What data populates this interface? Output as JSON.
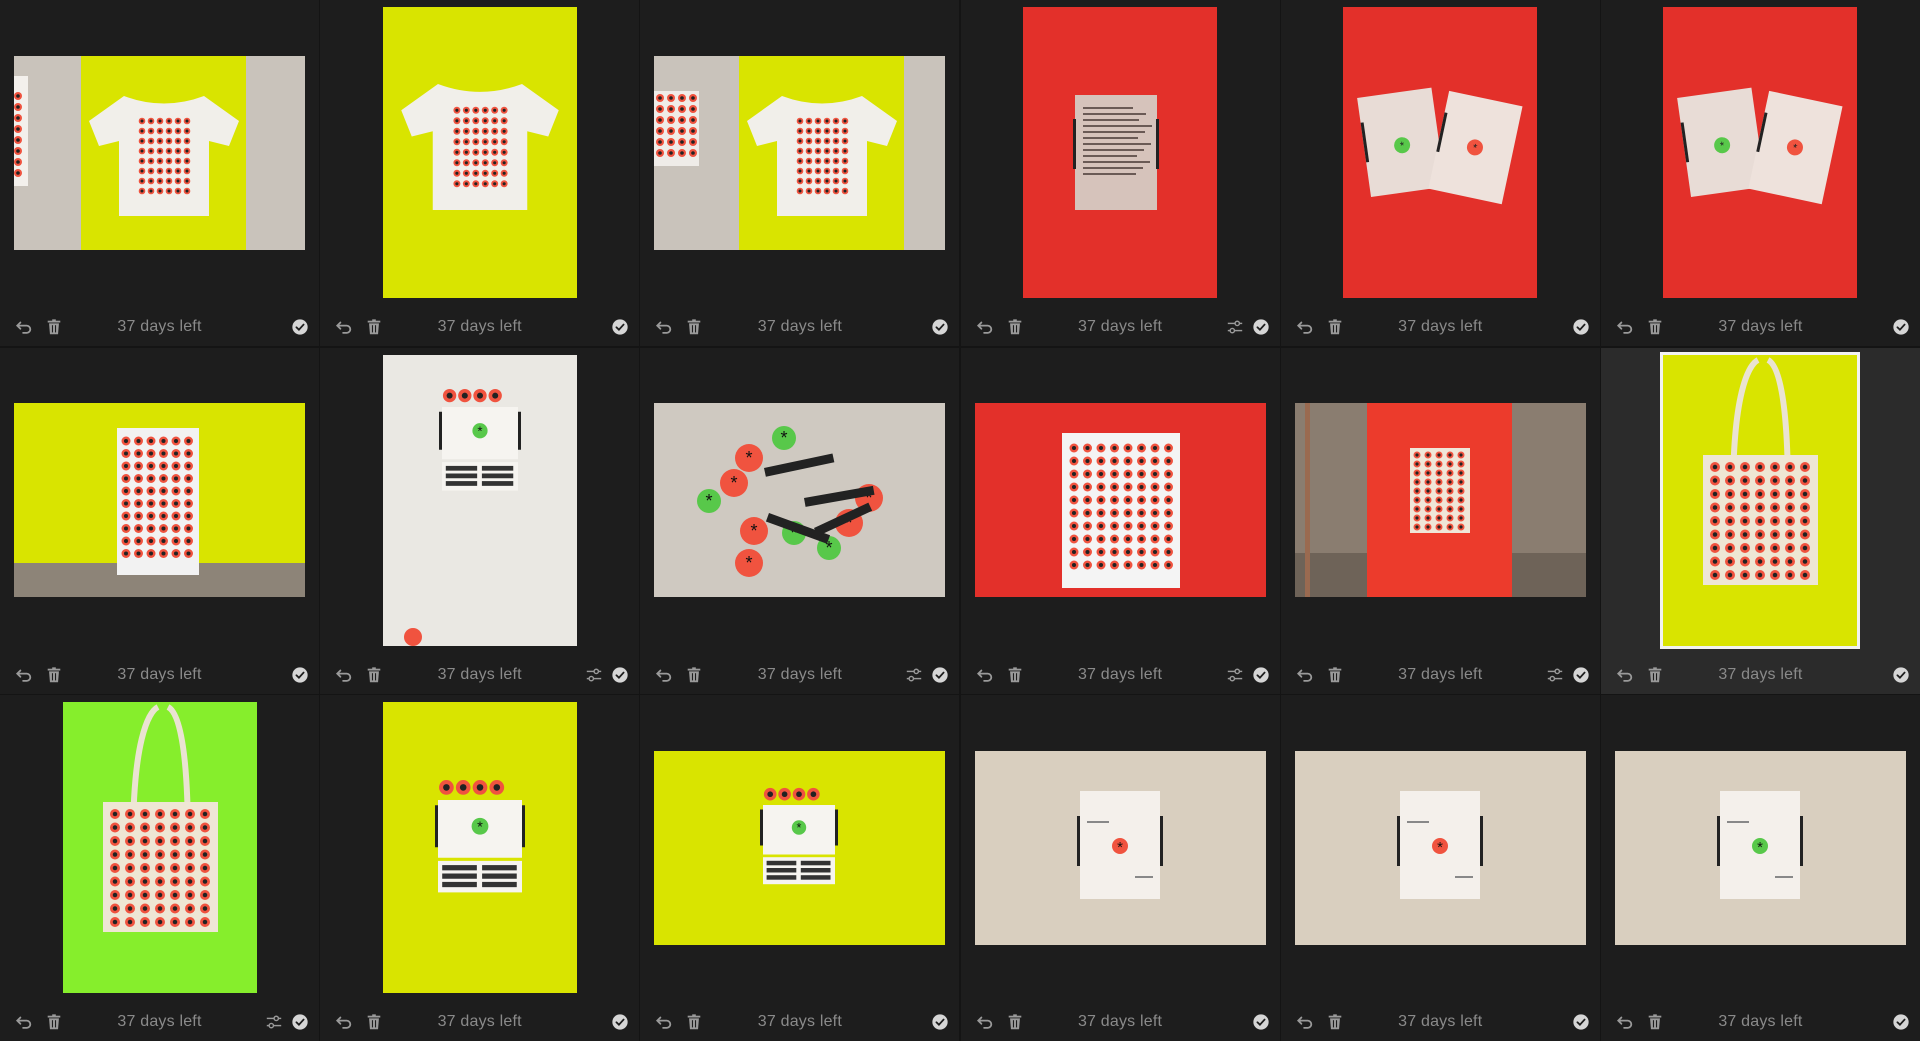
{
  "colors": {
    "background": "#1d1d1d",
    "selected_background": "#2b2b2b",
    "text": "#8a8a8a",
    "icon": "#9a9a9a",
    "check_fill": "#d6d6d6",
    "yellow": "#d7e600",
    "red": "#e02d24",
    "green": "#8bf02e",
    "beige": "#e0d6c6"
  },
  "photos": [
    {
      "status": "37 days left",
      "orientation": "landscape",
      "scene": "tshirt-side",
      "bg": "yellow",
      "edited": false,
      "selected": false
    },
    {
      "status": "37 days left",
      "orientation": "portrait",
      "scene": "tshirt",
      "bg": "yellow",
      "edited": false,
      "selected": false
    },
    {
      "status": "37 days left",
      "orientation": "landscape",
      "scene": "tshirt-wall",
      "bg": "yellow",
      "edited": false,
      "selected": false
    },
    {
      "status": "37 days left",
      "orientation": "portrait",
      "scene": "letter",
      "bg": "red",
      "edited": true,
      "selected": false
    },
    {
      "status": "37 days left",
      "orientation": "portrait",
      "scene": "two-cards",
      "bg": "red",
      "edited": false,
      "selected": false
    },
    {
      "status": "37 days left",
      "orientation": "portrait",
      "scene": "two-cards",
      "bg": "red",
      "edited": false,
      "selected": false
    },
    {
      "status": "37 days left",
      "orientation": "landscape",
      "scene": "poster-hanging",
      "bg": "yellow",
      "edited": false,
      "selected": false
    },
    {
      "status": "37 days left",
      "orientation": "portrait",
      "scene": "kit-wall",
      "bg": "white",
      "edited": true,
      "selected": false
    },
    {
      "status": "37 days left",
      "orientation": "landscape",
      "scene": "stickers",
      "bg": "grey",
      "edited": true,
      "selected": false
    },
    {
      "status": "37 days left",
      "orientation": "landscape",
      "scene": "poster-big",
      "bg": "red",
      "edited": true,
      "selected": false
    },
    {
      "status": "37 days left",
      "orientation": "landscape",
      "scene": "poster-room",
      "bg": "red",
      "edited": true,
      "selected": false
    },
    {
      "status": "37 days left",
      "orientation": "portrait",
      "scene": "tote",
      "bg": "yellow",
      "edited": false,
      "selected": true
    },
    {
      "status": "37 days left",
      "orientation": "portrait",
      "scene": "tote",
      "bg": "green",
      "edited": true,
      "selected": false
    },
    {
      "status": "37 days left",
      "orientation": "portrait",
      "scene": "kit",
      "bg": "yellow",
      "edited": false,
      "selected": false
    },
    {
      "status": "37 days left",
      "orientation": "landscape",
      "scene": "kit",
      "bg": "yellow",
      "edited": false,
      "selected": false
    },
    {
      "status": "37 days left",
      "orientation": "landscape",
      "scene": "card-single",
      "bg": "beige",
      "dot": "red",
      "edited": false,
      "selected": false
    },
    {
      "status": "37 days left",
      "orientation": "landscape",
      "scene": "card-single",
      "bg": "beige",
      "dot": "red",
      "edited": false,
      "selected": false
    },
    {
      "status": "37 days left",
      "orientation": "landscape",
      "scene": "card-single",
      "bg": "beige",
      "dot": "green",
      "edited": false,
      "selected": false
    }
  ],
  "icons": {
    "undo": "undo-icon",
    "trash": "trash-icon",
    "adjust": "adjust-sliders-icon",
    "check": "check-circle-icon"
  }
}
